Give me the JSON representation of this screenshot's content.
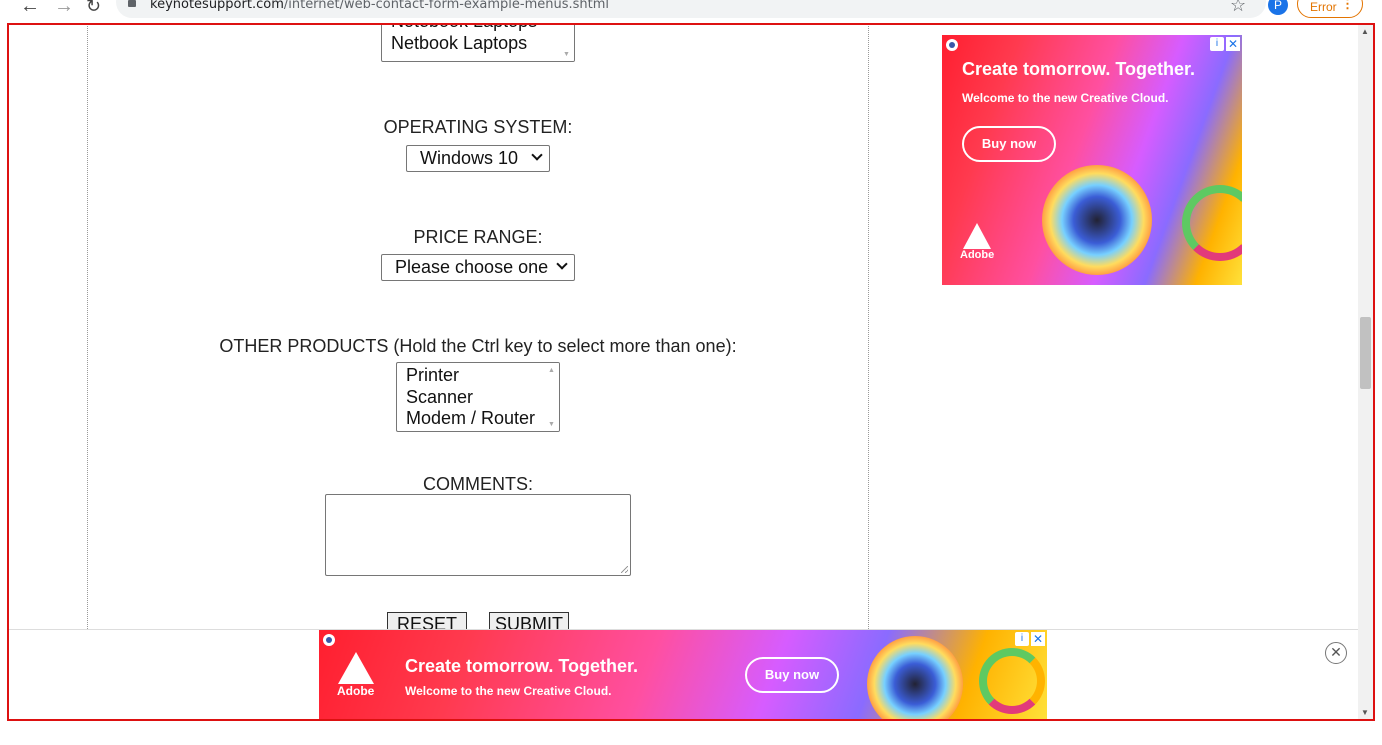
{
  "browser": {
    "url_domain": "keynotesupport.com",
    "url_path": "/internet/web-contact-form-example-menus.shtml",
    "profile_initial": "P",
    "error_label": "Error"
  },
  "form": {
    "computer_type_visible_options": [
      "Notebook Laptops",
      "Netbook Laptops"
    ],
    "os_label": "OPERATING SYSTEM:",
    "os_selected": "Windows 10",
    "price_label": "PRICE RANGE:",
    "price_selected": "Please choose one",
    "other_label": "OTHER PRODUCTS (Hold the Ctrl key to select more than one):",
    "other_options": [
      "Printer",
      "Scanner",
      "Modem / Router"
    ],
    "comments_label": "COMMENTS:",
    "reset_label": "RESET",
    "submit_label": "SUBMIT"
  },
  "side_ad": {
    "headline": "Create tomorrow. Together.",
    "subline": "Welcome to the new Creative Cloud.",
    "cta": "Buy now",
    "brand": "Adobe"
  },
  "bottom_ad": {
    "headline": "Create tomorrow. Together.",
    "subline": "Welcome to the new Creative Cloud.",
    "cta": "Buy now",
    "brand": "Adobe"
  },
  "icons": [
    "back-arrow-icon",
    "forward-arrow-icon",
    "reload-icon",
    "lock-icon",
    "star-icon",
    "more-icon",
    "adchoices-icon",
    "ad-close-icon",
    "close-icon"
  ]
}
